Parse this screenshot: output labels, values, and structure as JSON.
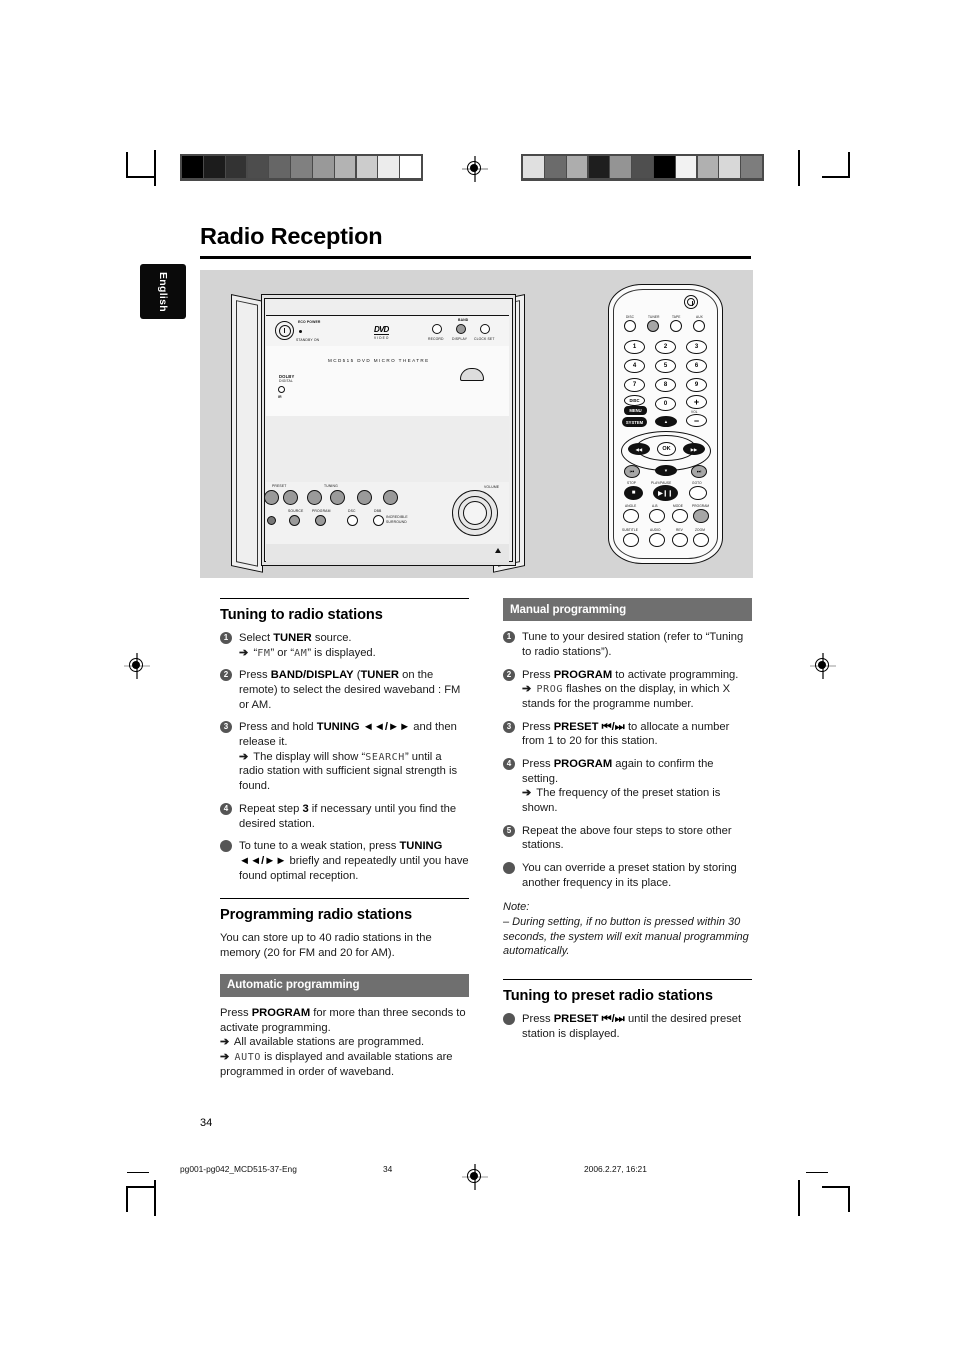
{
  "page": {
    "title": "Radio Reception",
    "language_tab": "English",
    "page_number": "34"
  },
  "footer": {
    "file": "pg001-pg042_MCD515-37-Eng",
    "page": "34",
    "timestamp": "2006.2.27, 16:21"
  },
  "illustration": {
    "unit": {
      "eco_power": "ECO POWER",
      "standby_on": "STANDBY ON",
      "dvd_logo": "DVD",
      "dvd_sub": "VIDEO",
      "record": "RECORD",
      "band": "BAND",
      "display": "DISPLAY",
      "clock_set": "CLOCK SET",
      "model_name": "MCD515 DVD MICRO THEATRE",
      "dolby": "DOLBY",
      "dolby_sub": "DIGITAL",
      "ir": "IR",
      "preset": "PRESET",
      "tuning": "TUNING",
      "volume": "VOLUME",
      "source": "SOURCE",
      "program": "PROGRAM",
      "dsc": "DSC",
      "dbb": "DBB",
      "incredible": "INCREDIBLE",
      "surround": "SURROUND"
    },
    "remote": {
      "power_icon": "power-icon",
      "sources": [
        "DISC",
        "TUNER",
        "TAPE",
        "AUX"
      ],
      "numbers": [
        "1",
        "2",
        "3",
        "4",
        "5",
        "6",
        "7",
        "8",
        "9",
        "0"
      ],
      "disc_menu": "DISC",
      "menu": "MENU",
      "system": "SYSTEM",
      "vol_plus": "+",
      "vol_minus": "−",
      "vol_label": "VOL",
      "ok": "OK",
      "stop": "STOP",
      "play_pause": "PLAY/PAUSE",
      "goto": "GOTO",
      "angle": "ANGLE",
      "ab": "A-B",
      "mode": "MODE",
      "program": "PROGRAM",
      "subtitle": "SUBTITLE",
      "audio": "AUDIO",
      "rev": "REV",
      "zoom": "ZOOM"
    }
  },
  "left_column": {
    "heading1": "Tuning to radio stations",
    "steps": [
      {
        "marker": "1",
        "segments": [
          {
            "t": "Select "
          },
          {
            "t": "TUNER",
            "b": true
          },
          {
            "t": " source."
          }
        ],
        "sub": [
          {
            "arrow": true,
            "segments": [
              {
                "t": "“"
              },
              {
                "t": "FM",
                "lcd": true
              },
              {
                "t": "” or “"
              },
              {
                "t": "AM",
                "lcd": true
              },
              {
                "t": "” is displayed."
              }
            ]
          }
        ]
      },
      {
        "marker": "2",
        "segments": [
          {
            "t": "Press "
          },
          {
            "t": "BAND/DISPLAY",
            "b": true
          },
          {
            "t": " ("
          },
          {
            "t": "TUNER",
            "b": true
          },
          {
            "t": " on the remote) to select the desired waveband : FM or AM."
          }
        ],
        "sub": []
      },
      {
        "marker": "3",
        "segments": [
          {
            "t": "Press and hold "
          },
          {
            "t": "TUNING",
            "b": true
          },
          {
            "t": " ◄◄/►►",
            "b": true
          },
          {
            "t": " and then release it."
          }
        ],
        "sub": [
          {
            "arrow": true,
            "segments": [
              {
                "t": "The display will show “"
              },
              {
                "t": "SEARCH",
                "lcd": true
              },
              {
                "t": "” until a radio station with sufficient signal strength is found."
              }
            ]
          }
        ]
      },
      {
        "marker": "4",
        "segments": [
          {
            "t": "Repeat step "
          },
          {
            "t": "3",
            "b": true
          },
          {
            "t": " if necessary until you find the desired station."
          }
        ],
        "sub": []
      },
      {
        "marker": "●",
        "segments": [
          {
            "t": "To tune to a weak station, press "
          },
          {
            "t": "TUNING",
            "b": true
          },
          {
            "t": " ◄◄/►►",
            "b": true
          },
          {
            "t": " briefly and repeatedly until you have found optimal reception."
          }
        ],
        "sub": []
      }
    ],
    "heading2": "Programming radio stations",
    "intro": "You can store up to 40 radio stations in the memory (20 for FM and 20 for AM).",
    "band_heading": "Automatic programming",
    "auto_steps": [
      {
        "marker": "",
        "segments": [
          {
            "t": "Press "
          },
          {
            "t": "PROGRAM",
            "b": true
          },
          {
            "t": " for more than three seconds to activate programming."
          }
        ],
        "sub": [
          {
            "arrow": true,
            "segments": [
              {
                "t": "All available stations are programmed."
              }
            ]
          },
          {
            "arrow": true,
            "segments": [
              {
                "t": ""
              },
              {
                "t": "AUTO",
                "lcd": true
              },
              {
                "t": " is displayed and available stations are programmed in order of waveband."
              }
            ]
          }
        ]
      }
    ]
  },
  "right_column": {
    "band_heading": "Manual programming",
    "steps": [
      {
        "marker": "1",
        "segments": [
          {
            "t": "Tune to your desired station (refer to “Tuning to radio stations”)."
          }
        ],
        "sub": []
      },
      {
        "marker": "2",
        "segments": [
          {
            "t": "Press "
          },
          {
            "t": "PROGRAM",
            "b": true
          },
          {
            "t": " to activate programming."
          }
        ],
        "sub": [
          {
            "arrow": true,
            "segments": [
              {
                "t": ""
              },
              {
                "t": "PROG",
                "lcd": true
              },
              {
                "t": " flashes on the display, in which X stands for the programme number."
              }
            ]
          }
        ]
      },
      {
        "marker": "3",
        "segments": [
          {
            "t": "Press "
          },
          {
            "t": "PRESET",
            "b": true
          },
          {
            "t": " ⏮/⏭",
            "b": true
          },
          {
            "t": " to allocate a number from 1 to 20 for this station."
          }
        ],
        "sub": []
      },
      {
        "marker": "4",
        "segments": [
          {
            "t": "Press "
          },
          {
            "t": "PROGRAM",
            "b": true
          },
          {
            "t": " again to confirm the setting."
          }
        ],
        "sub": [
          {
            "arrow": true,
            "segments": [
              {
                "t": "The frequency of the preset station is shown."
              }
            ]
          }
        ]
      },
      {
        "marker": "5",
        "segments": [
          {
            "t": "Repeat the above four steps to store other stations."
          }
        ],
        "sub": []
      },
      {
        "marker": "●",
        "segments": [
          {
            "t": "You can override a preset station by storing another frequency in its place."
          }
        ],
        "sub": []
      }
    ],
    "note_title": "Note:",
    "note_body": "–  During setting, if no button is pressed within 30 seconds, the system will exit manual programming automatically.",
    "heading_preset": "Tuning to preset radio stations",
    "preset_steps": [
      {
        "marker": "●",
        "segments": [
          {
            "t": "Press "
          },
          {
            "t": "PRESET",
            "b": true
          },
          {
            "t": " ⏮/⏭",
            "b": true
          },
          {
            "t": "  until the desired preset station is displayed."
          }
        ],
        "sub": []
      }
    ]
  },
  "print_marks": {
    "colorbar_left": [
      "#000000",
      "#1c1c1c",
      "#333333",
      "#4d4d4d",
      "#666666",
      "#808080",
      "#999999",
      "#b3b3b3",
      "#cccccc",
      "#ececec",
      "#ffffff"
    ],
    "colorbar_right": [
      "#e0e0e0",
      "#6b6b6b",
      "#adadad",
      "#1e1e1e",
      "#949494",
      "#4f4f4f",
      "#000000",
      "#f2f2f2",
      "#b0b0b0",
      "#d8d8d8",
      "#7d7d7d"
    ]
  }
}
